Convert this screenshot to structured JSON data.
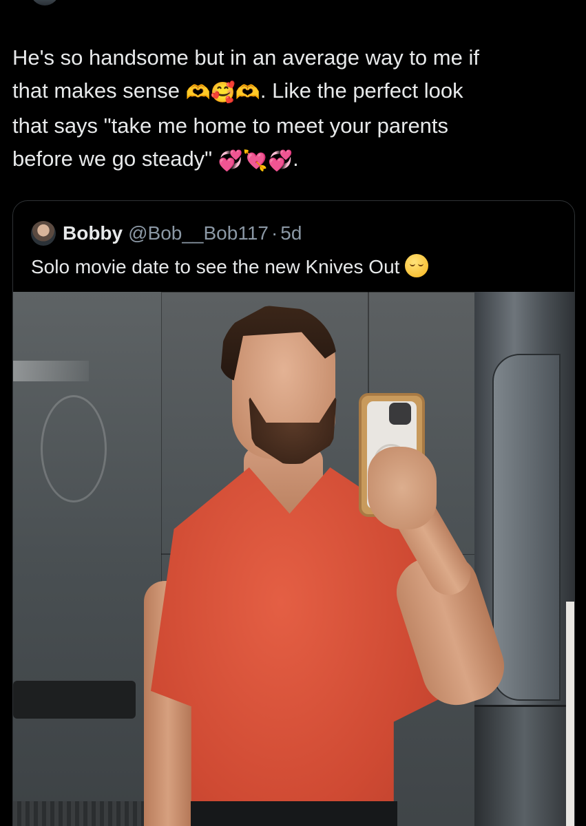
{
  "post": {
    "line1": "He's so handsome but in an average way to me if",
    "line2_a": "that makes sense ",
    "line2_emojis": "🫶🥰🫶",
    "line2_b": ". Like the perfect look",
    "line3": "that says \"take me home to meet your parents",
    "line4_a": "before we go steady\" ",
    "line4_emojis": "💞💘💞",
    "line4_b": "."
  },
  "quote": {
    "name": "Bobby",
    "handle": "@Bob__Bob117",
    "separator": "·",
    "time": "5d",
    "text": "Solo movie date to see the new Knives Out"
  },
  "icons": {
    "avatar": "profile-avatar",
    "relieved": "relieved-face-emoji"
  },
  "colors": {
    "background": "#000000",
    "text": "#e7e9ea",
    "secondary_text": "#8b98a5",
    "card_border": "#2f3336",
    "shirt": "#d9533b"
  }
}
